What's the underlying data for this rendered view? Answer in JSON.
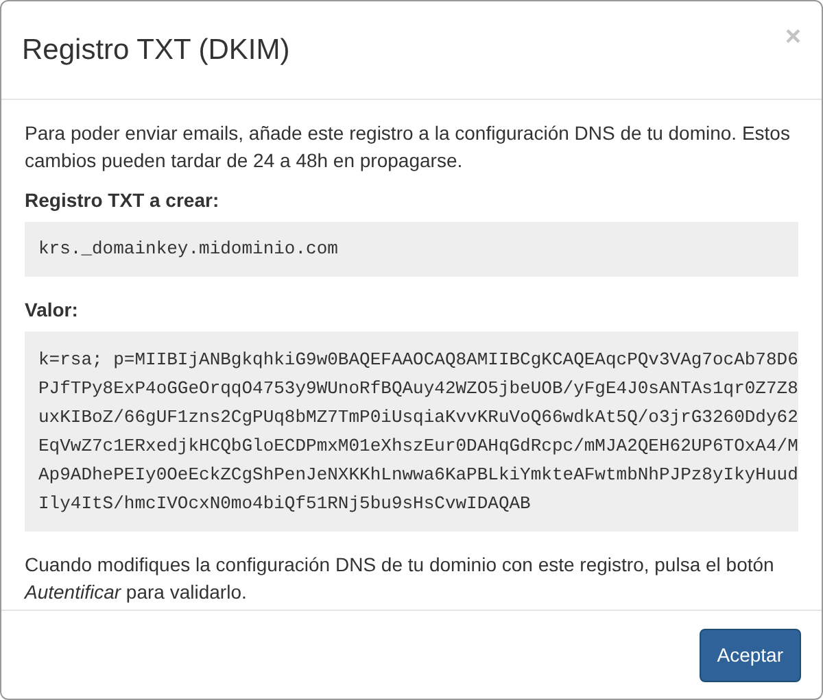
{
  "modal": {
    "title": "Registro TXT (DKIM)",
    "close": "×",
    "intro": "Para poder enviar emails, añade este registro a la configuración DNS de tu domino. Estos cambios pueden tardar de 24 a 48h en propagarse.",
    "record_label": "Registro TXT a crear:",
    "record": "krs._domainkey.midominio.com",
    "value_label": "Valor:",
    "value": "k=rsa; p=MIIBIjANBgkqhkiG9w0BAQEFAAOCAQ8AMIIBCgKCAQEAqcPQv3VAg7ocAb78D6\nPJfTPy8ExP4oGGeOrqqO4753y9WUnoRfBQAuy42WZO5jbeUOB/yFgE4J0sANTAs1qr0Z7Z8\nuxKIBoZ/66gUF1zns2CgPUq8bMZ7TmP0iUsqiaKvvKRuVoQ66wdkAt5Q/o3jrG3260Ddy62\nEqVwZ7c1ERxedjkHCQbGloECDPmxM01eXhszEur0DAHqGdRcpc/mMJA2QEH62UP6TOxA4/M\nAp9ADhePEIy0OeEckZCgShPenJeNXKKhLnwwa6KaPBLkiYmkteAFwtmbNhPJPz8yIkyHuud\nIly4ItS/hmcIVOcxN0mo4biQf51RNj5bu9sHsCvwIDAQAB",
    "footer_note": "Cuando modifiques la configuración DNS de tu dominio con este registro, pulsa el botón *Autentificar* para validarlo.",
    "buttons": [
      "Aceptar"
    ]
  }
}
